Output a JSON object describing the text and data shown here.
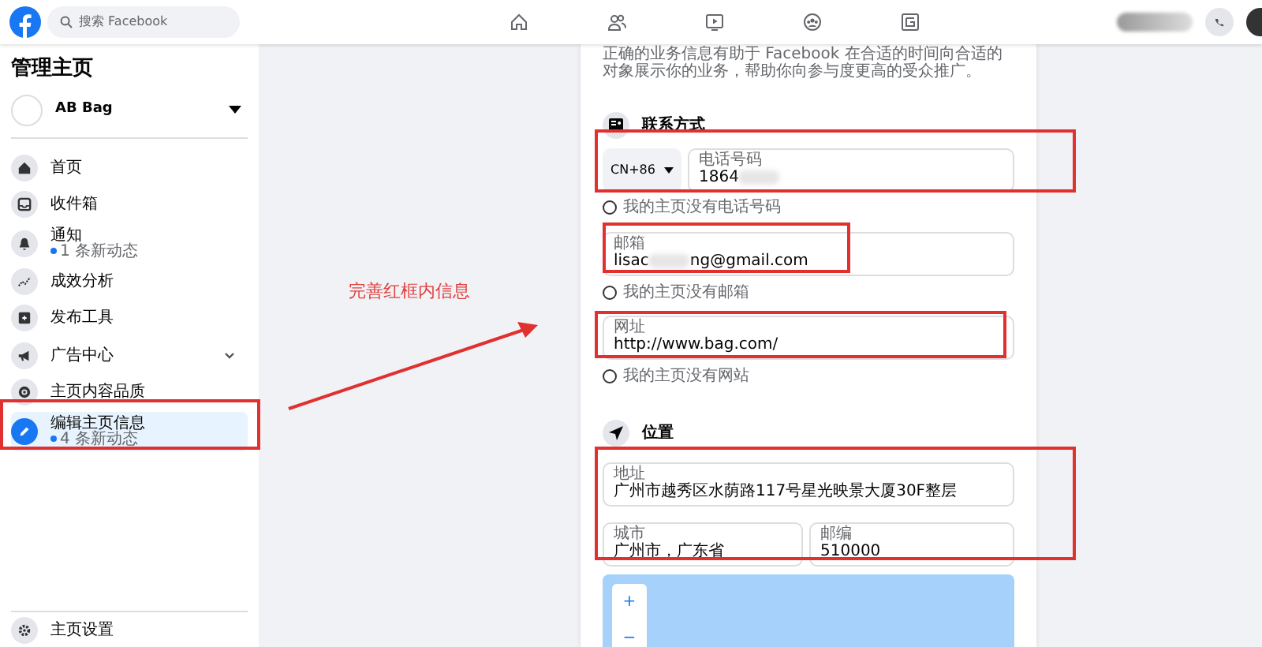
{
  "top_bar": {
    "search": {
      "placeholder": "搜索 Facebook"
    }
  },
  "sidebar": {
    "title": "管理主页",
    "page": {
      "name": "AB Bag"
    },
    "items": [
      {
        "label": "首页",
        "selected": false
      },
      {
        "label": "收件箱",
        "selected": false
      },
      {
        "label": "通知",
        "sub": "1 条新动态",
        "selected": false
      },
      {
        "label": "成效分析",
        "selected": false
      },
      {
        "label": "发布工具",
        "selected": false
      },
      {
        "label": "广告中心",
        "expandable": true,
        "selected": false
      },
      {
        "label": "主页内容品质",
        "selected": false
      },
      {
        "label": "编辑主页信息",
        "sub": "4 条新动态",
        "selected": true
      }
    ],
    "footer_item": "主页设置"
  },
  "annotation": {
    "text": "完善红框内信息"
  },
  "form": {
    "intro": "正确的业务信息有助于 Facebook 在合适的时间向合适的对象展示你的业务，帮助你向参与度更高的受众推广。",
    "contact": {
      "title": "联系方式",
      "country_code": "CN+86",
      "phone": {
        "label": "电话号码",
        "value": "1864"
      },
      "no_phone": {
        "label": "我的主页没有电话号码",
        "checked": false
      },
      "email": {
        "label": "邮箱",
        "value_start": "lisac",
        "value_end": "ng@gmail.com"
      },
      "no_email": {
        "label": "我的主页没有邮箱",
        "checked": false
      },
      "website": {
        "label": "网址",
        "value": "http://www.bag.com/"
      },
      "no_website": {
        "label": "我的主页没有网站",
        "checked": false
      }
    },
    "location": {
      "title": "位置",
      "address": {
        "label": "地址",
        "value": "广州市越秀区水荫路117号星光映景大厦30F整层"
      },
      "city": {
        "label": "城市",
        "value": "广州市，广东省"
      },
      "zip": {
        "label": "邮编",
        "value": "510000"
      },
      "map": {
        "zoom_in": "+",
        "zoom_out": "−"
      }
    }
  }
}
